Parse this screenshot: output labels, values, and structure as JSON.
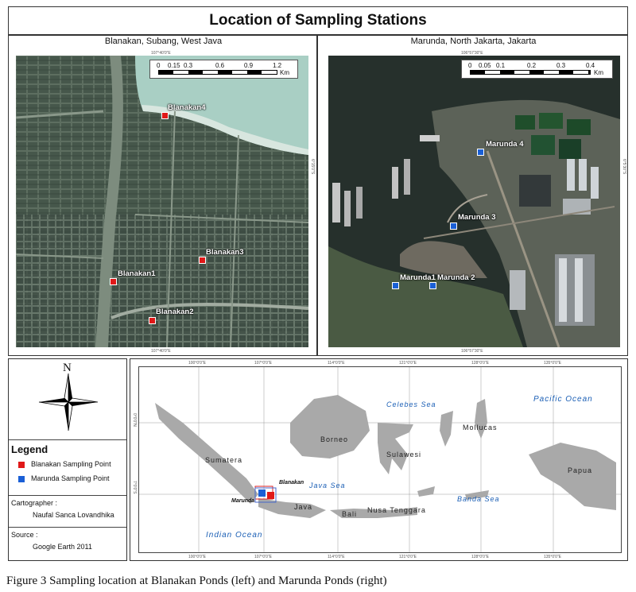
{
  "title": "Location of Sampling Stations",
  "left_map": {
    "title": "Blanakan, Subang, West Java",
    "scale": {
      "ticks": [
        "0",
        "0.15",
        "0.3",
        "0.6",
        "0.9",
        "1.2"
      ],
      "unit": "Km"
    },
    "top_coord": "107°40'0\"E",
    "bottom_coord": "107°40'0\"E",
    "side_coord": "6°15'0\"S",
    "points": [
      {
        "label": "Blanakan4",
        "color": "red"
      },
      {
        "label": "Blanakan3",
        "color": "red"
      },
      {
        "label": "Blanakan1",
        "color": "red"
      },
      {
        "label": "Blanakan2",
        "color": "red"
      }
    ]
  },
  "right_map": {
    "title": "Marunda, North Jakarta, Jakarta",
    "scale": {
      "ticks": [
        "0",
        "0.05",
        "0.1",
        "0.2",
        "0.3",
        "0.4"
      ],
      "unit": "Km"
    },
    "top_coord": "106°57'30\"E",
    "bottom_coord": "106°57'30\"E",
    "side_coord": "6°5'30\"S",
    "points": [
      {
        "label": "Marunda 4",
        "color": "blue"
      },
      {
        "label": "Marunda 3",
        "color": "blue"
      },
      {
        "label": "Marunda1",
        "color": "blue"
      },
      {
        "label": "Marunda 2",
        "color": "blue"
      }
    ]
  },
  "compass": {
    "label": "N"
  },
  "legend": {
    "heading": "Legend",
    "items": [
      {
        "label": "Blanakan Sampling Point",
        "color": "#e01818"
      },
      {
        "label": "Marunda Sampling Point",
        "color": "#1a5fd6"
      }
    ]
  },
  "cartographer": {
    "heading": "Cartographer  :",
    "name": "Naufal Sanca Lovandhika"
  },
  "source": {
    "heading": "Source :",
    "value": "Google Earth 2011"
  },
  "overview": {
    "top_ticks": [
      "100°0'0\"E",
      "107°0'0\"E",
      "114°0'0\"E",
      "121°0'0\"E",
      "128°0'0\"E",
      "135°0'0\"E"
    ],
    "bottom_ticks": [
      "100°0'0\"E",
      "107°0'0\"E",
      "114°0'0\"E",
      "121°0'0\"E",
      "128°0'0\"E",
      "135°0'0\"E"
    ],
    "left_ticks": [
      "0°0'0\"N",
      "7°0'0\"S"
    ],
    "seas": [
      "Pacific Ocean",
      "Celebes Sea",
      "Java Sea",
      "Banda Sea",
      "Indian Ocean"
    ],
    "islands": [
      "Borneo",
      "Sumatera",
      "Sulawesi",
      "Mollucas",
      "Papua",
      "Java",
      "Bali",
      "Nusa Tenggara"
    ],
    "markers": [
      "Blanakan",
      "Marunda"
    ]
  },
  "caption": "Figure 3 Sampling location at Blanakan Ponds (left) and Marunda Ponds (right)"
}
